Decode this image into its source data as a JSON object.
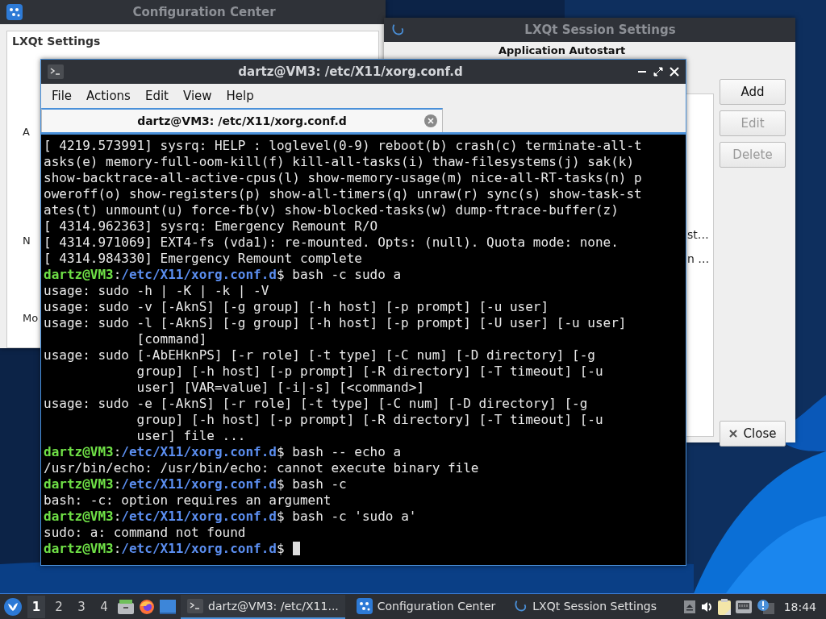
{
  "config_window": {
    "title": "Configuration Center",
    "panel_title": "LXQt Settings",
    "peek_labels": [
      "A",
      "N",
      "Mo"
    ]
  },
  "session_window": {
    "title": "LXQt Session Settings",
    "heading": "Application Autostart",
    "list_items": [
      "st…",
      "n …"
    ],
    "buttons": [
      {
        "label": "Add",
        "disabled": false
      },
      {
        "label": "Edit",
        "disabled": true
      },
      {
        "label": "Delete",
        "disabled": true
      }
    ],
    "close_button": "Close"
  },
  "terminal": {
    "title": "dartz@VM3: /etc/X11/xorg.conf.d",
    "menu": [
      "File",
      "Actions",
      "Edit",
      "View",
      "Help"
    ],
    "tabs": [
      {
        "label": "dartz@VM3: /etc/X11/xorg.conf.d",
        "selected": true
      }
    ],
    "lines": [
      {
        "kind": "output",
        "text": "[ 4219.573991] sysrq: HELP : loglevel(0-9) reboot(b) crash(c) terminate-all-t"
      },
      {
        "kind": "output",
        "text": "asks(e) memory-full-oom-kill(f) kill-all-tasks(i) thaw-filesystems(j) sak(k)"
      },
      {
        "kind": "output",
        "text": "show-backtrace-all-active-cpus(l) show-memory-usage(m) nice-all-RT-tasks(n) p"
      },
      {
        "kind": "output",
        "text": "oweroff(o) show-registers(p) show-all-timers(q) unraw(r) sync(s) show-task-st"
      },
      {
        "kind": "output",
        "text": "ates(t) unmount(u) force-fb(v) show-blocked-tasks(w) dump-ftrace-buffer(z)"
      },
      {
        "kind": "output",
        "text": "[ 4314.962363] sysrq: Emergency Remount R/O"
      },
      {
        "kind": "output",
        "text": "[ 4314.971069] EXT4-fs (vda1): re-mounted. Opts: (null). Quota mode: none."
      },
      {
        "kind": "output",
        "text": "[ 4314.984330] Emergency Remount complete"
      },
      {
        "kind": "prompt",
        "user": "dartz@VM3",
        "sep": ":",
        "path": "/etc/X11/xorg.conf.d",
        "command": "$ bash -c sudo a"
      },
      {
        "kind": "output",
        "text": "usage: sudo -h | -K | -k | -V"
      },
      {
        "kind": "output",
        "text": "usage: sudo -v [-AknS] [-g group] [-h host] [-p prompt] [-u user]"
      },
      {
        "kind": "output",
        "text": "usage: sudo -l [-AknS] [-g group] [-h host] [-p prompt] [-U user] [-u user]"
      },
      {
        "kind": "continuation",
        "text": "[command]"
      },
      {
        "kind": "output",
        "text": "usage: sudo [-AbEHknPS] [-r role] [-t type] [-C num] [-D directory] [-g"
      },
      {
        "kind": "continuation",
        "text": "group] [-h host] [-p prompt] [-R directory] [-T timeout] [-u"
      },
      {
        "kind": "continuation",
        "text": "user] [VAR=value] [-i|-s] [<command>]"
      },
      {
        "kind": "output",
        "text": "usage: sudo -e [-AknS] [-r role] [-t type] [-C num] [-D directory] [-g"
      },
      {
        "kind": "continuation",
        "text": "group] [-h host] [-p prompt] [-R directory] [-T timeout] [-u"
      },
      {
        "kind": "continuation",
        "text": "user] file ..."
      },
      {
        "kind": "prompt",
        "user": "dartz@VM3",
        "sep": ":",
        "path": "/etc/X11/xorg.conf.d",
        "command": "$ bash -- echo a"
      },
      {
        "kind": "output",
        "text": "/usr/bin/echo: /usr/bin/echo: cannot execute binary file"
      },
      {
        "kind": "prompt",
        "user": "dartz@VM3",
        "sep": ":",
        "path": "/etc/X11/xorg.conf.d",
        "command": "$ bash -c"
      },
      {
        "kind": "output",
        "text": "bash: -c: option requires an argument"
      },
      {
        "kind": "prompt",
        "user": "dartz@VM3",
        "sep": ":",
        "path": "/etc/X11/xorg.conf.d",
        "command": "$ bash -c 'sudo a'"
      },
      {
        "kind": "output",
        "text": "sudo: a: command not found"
      },
      {
        "kind": "prompt",
        "user": "dartz@VM3",
        "sep": ":",
        "path": "/etc/X11/xorg.conf.d",
        "command": "$",
        "cursor": true
      }
    ]
  },
  "taskbar": {
    "desktops": [
      {
        "label": "1",
        "selected": true
      },
      {
        "label": "2",
        "selected": false
      },
      {
        "label": "3",
        "selected": false
      },
      {
        "label": "4",
        "selected": false
      }
    ],
    "launchers": [
      {
        "kind": "files"
      },
      {
        "kind": "browser"
      },
      {
        "kind": "desktop"
      }
    ],
    "tasks": [
      {
        "label": "dartz@VM3: /etc/X11...",
        "kind": "terminal",
        "selected": true
      },
      {
        "label": "Configuration Center",
        "kind": "config",
        "selected": false
      },
      {
        "label": "LXQt Session Settings",
        "kind": "session",
        "selected": false
      }
    ],
    "tray": [
      {
        "kind": "eject"
      },
      {
        "kind": "volume"
      },
      {
        "kind": "clipboard"
      },
      {
        "kind": "network"
      },
      {
        "kind": "notification"
      }
    ],
    "clock": "18:44"
  }
}
